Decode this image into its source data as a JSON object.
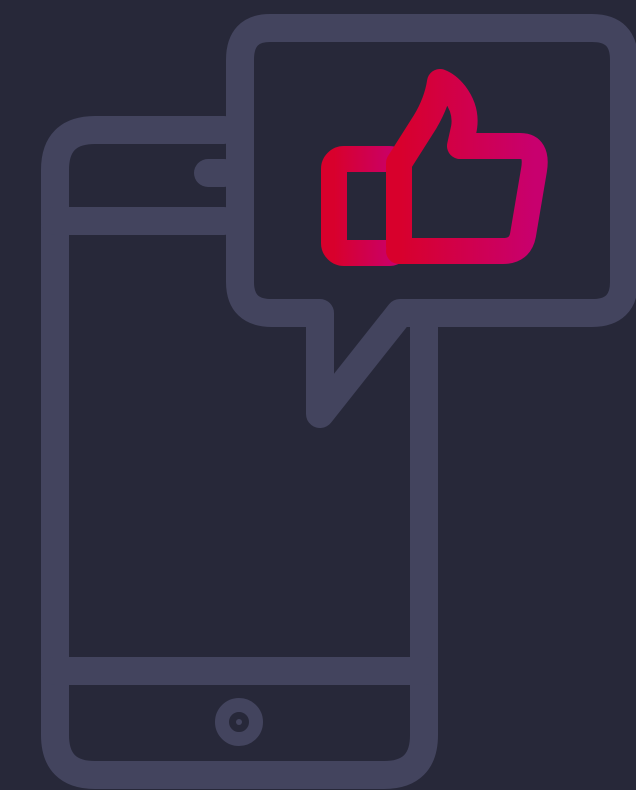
{
  "colors": {
    "background": "#272839",
    "outline": "#43445E",
    "accent_start": "#D8002C",
    "accent_end": "#C8006E"
  },
  "icons": {
    "phone": "smartphone-icon",
    "bubble": "speech-bubble-icon",
    "like": "thumbs-up-icon"
  }
}
